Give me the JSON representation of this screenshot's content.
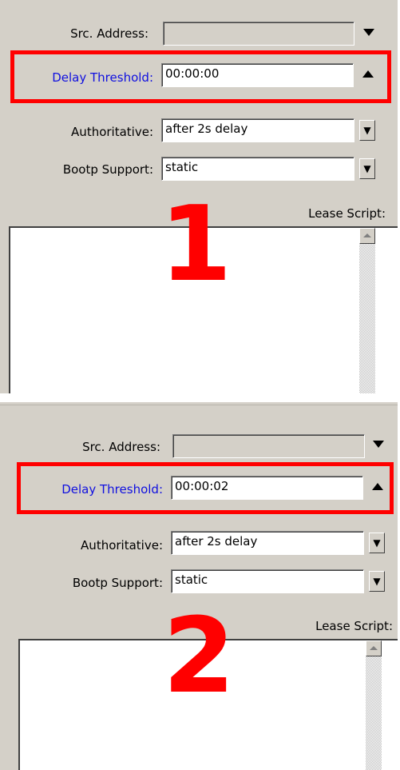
{
  "panel1": {
    "src_address_label": "Src. Address:",
    "src_address_value": "",
    "delay_label": "Delay Threshold:",
    "delay_value": "00:00:00",
    "authoritative_label": "Authoritative:",
    "authoritative_value": "after 2s delay",
    "bootp_label": "Bootp Support:",
    "bootp_value": "static",
    "lease_label": "Lease Script:",
    "step_number": "1"
  },
  "panel2": {
    "src_address_label": "Src. Address:",
    "src_address_value": "",
    "delay_label": "Delay Threshold:",
    "delay_value": "00:00:02",
    "authoritative_label": "Authoritative:",
    "authoritative_value": "after 2s delay",
    "bootp_label": "Bootp Support:",
    "bootp_value": "static",
    "lease_label": "Lease Script:",
    "step_number": "2"
  },
  "colors": {
    "highlight": "#ff0000",
    "label_link": "#1010e0",
    "panel_bg": "#d4d0c8"
  },
  "icons": {
    "dropdown": "triangle-down",
    "collapse": "triangle-up",
    "combo": "combo-arrow"
  }
}
